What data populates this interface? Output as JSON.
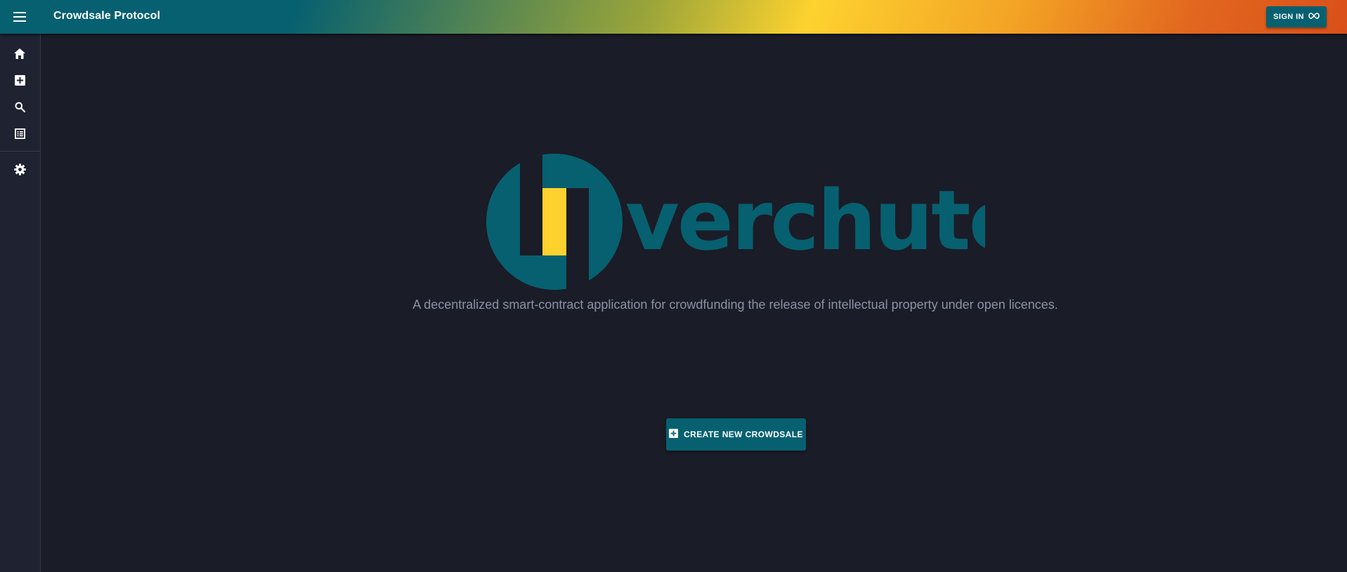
{
  "appbar": {
    "title": "Crowdsale Protocol",
    "menu_icon": "menu-icon",
    "signin_label": "SIGN IN",
    "signin_icon": "infinity-icon",
    "gradient_colors": [
      "#07606f",
      "#9aa53a",
      "#fdd22f",
      "#f3a325",
      "#d9501a"
    ]
  },
  "sidebar": {
    "items": [
      {
        "icon": "home-icon",
        "label": "Home"
      },
      {
        "icon": "add-box-icon",
        "label": "Create"
      },
      {
        "icon": "search-icon",
        "label": "Search"
      },
      {
        "icon": "list-icon",
        "label": "List"
      },
      {
        "icon": "settings-icon",
        "label": "Settings"
      }
    ]
  },
  "hero": {
    "logo_text": "verchute",
    "logo_colors": {
      "primary": "#07606f",
      "accent": "#fdd22f"
    },
    "tagline": "A decentralized smart-contract application for crowdfunding the release of intellectual property under open licences.",
    "create_label": "CREATE NEW CROWDSALE",
    "create_icon": "add-box-icon"
  },
  "colors": {
    "background": "#1a1c27",
    "sidebar": "#1f2231",
    "button": "#07606f",
    "tagline": "#8a93a6"
  }
}
